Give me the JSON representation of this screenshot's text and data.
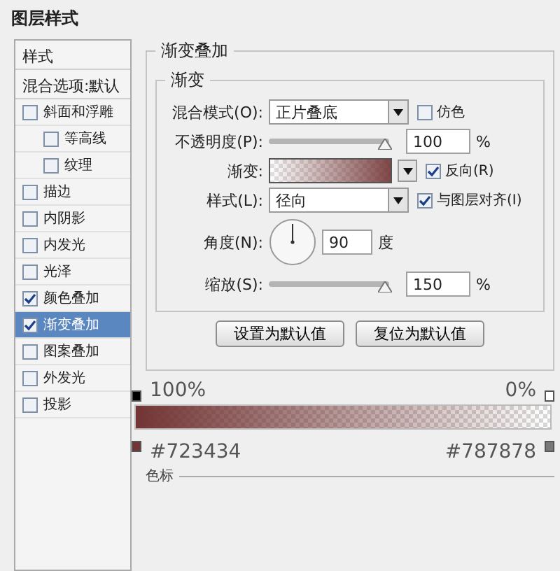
{
  "window": {
    "title": "图层样式"
  },
  "sidebar": {
    "header": "样式",
    "blending": "混合选项:默认",
    "items": [
      {
        "label": "斜面和浮雕",
        "checked": false,
        "selected": false,
        "children": [
          {
            "label": "等高线",
            "checked": false,
            "selected": false
          },
          {
            "label": "纹理",
            "checked": false,
            "selected": false
          }
        ]
      },
      {
        "label": "描边",
        "checked": false,
        "selected": false
      },
      {
        "label": "内阴影",
        "checked": false,
        "selected": false
      },
      {
        "label": "内发光",
        "checked": false,
        "selected": false
      },
      {
        "label": "光泽",
        "checked": false,
        "selected": false
      },
      {
        "label": "颜色叠加",
        "checked": true,
        "selected": false
      },
      {
        "label": "渐变叠加",
        "checked": true,
        "selected": true
      },
      {
        "label": "图案叠加",
        "checked": false,
        "selected": false
      },
      {
        "label": "外发光",
        "checked": false,
        "selected": false
      },
      {
        "label": "投影",
        "checked": false,
        "selected": false
      }
    ]
  },
  "panel": {
    "title": "渐变叠加",
    "group": "渐变",
    "blend_mode": {
      "label": "混合模式(O):",
      "value": "正片叠底"
    },
    "dither": {
      "label": "仿色",
      "checked": false
    },
    "opacity": {
      "label": "不透明度(P):",
      "level": 0.97,
      "value": "100",
      "unit": "%"
    },
    "gradient": {
      "label": "渐变:"
    },
    "reverse": {
      "label": "反向(R)",
      "checked": true
    },
    "style": {
      "label": "样式(L):",
      "value": "径向"
    },
    "align": {
      "label": "与图层对齐(I)",
      "checked": true
    },
    "angle": {
      "label": "角度(N):",
      "value": "90",
      "unit": "度"
    },
    "scale": {
      "label": "缩放(S):",
      "level": 0.97,
      "value": "150",
      "unit": "%"
    },
    "buttons": [
      "设置为默认值",
      "复位为默认值"
    ]
  },
  "gradient_editor": {
    "opacity_stops": [
      {
        "label": "100%",
        "color": "#000000"
      },
      {
        "label": "0%",
        "color": "#ffffff"
      }
    ],
    "color_stops": [
      {
        "label": "#723434",
        "color": "#723434"
      },
      {
        "label": "#787878",
        "color": "#787878"
      }
    ],
    "section": "色标"
  }
}
